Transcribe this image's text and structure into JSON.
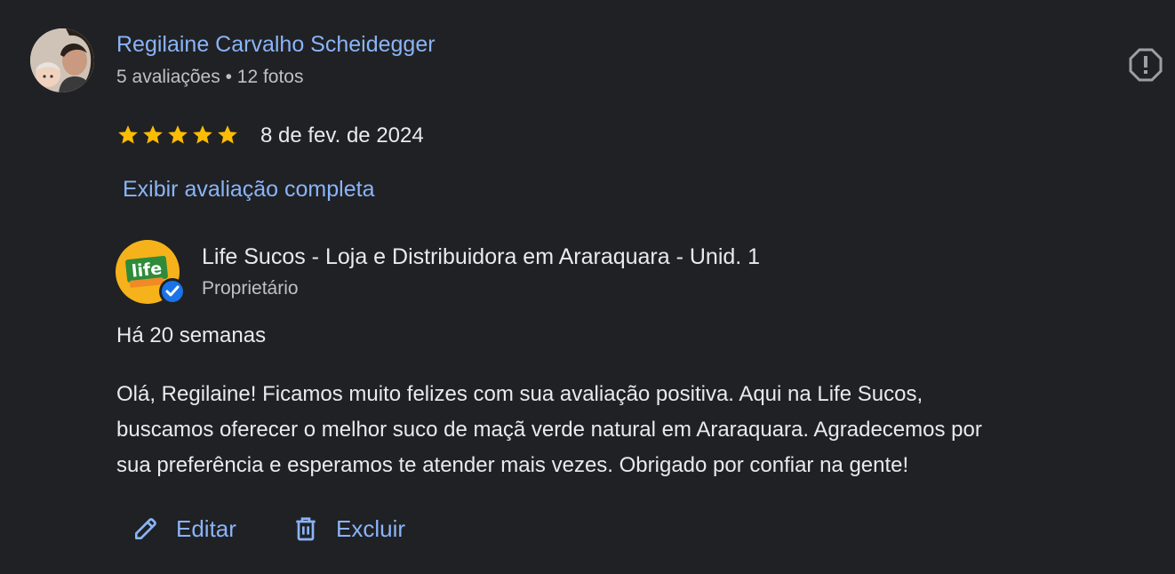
{
  "review": {
    "reviewer_name": "Regilaine Carvalho Scheidegger",
    "reviewer_meta": "5 avaliações • 12 fotos",
    "rating": 5,
    "date": "8 de fev. de 2024",
    "full_review_link": "Exibir avaliação completa",
    "report_icon": "report-octagon-icon"
  },
  "owner_response": {
    "business_name": "Life Sucos - Loja e Distribuidora em Araraquara - Unid. 1",
    "role": "Proprietário",
    "logo_text": "life",
    "time_ago": "Há 20 semanas",
    "text_lines": [
      "Olá, Regilaine! Ficamos muito felizes com sua avaliação positiva. Aqui na Life Sucos,",
      "buscamos oferecer o melhor suco de maçã verde natural em Araraquara. Agradecemos por",
      "sua preferência e esperamos te atender mais vezes. Obrigado por confiar na gente!"
    ]
  },
  "actions": {
    "edit_label": "Editar",
    "delete_label": "Excluir"
  },
  "colors": {
    "background": "#202124",
    "link": "#8ab4f8",
    "star": "#fbbc04",
    "text": "#e8eaed",
    "secondary_text": "#bdc1c6",
    "verified_badge": "#1a73e8"
  }
}
